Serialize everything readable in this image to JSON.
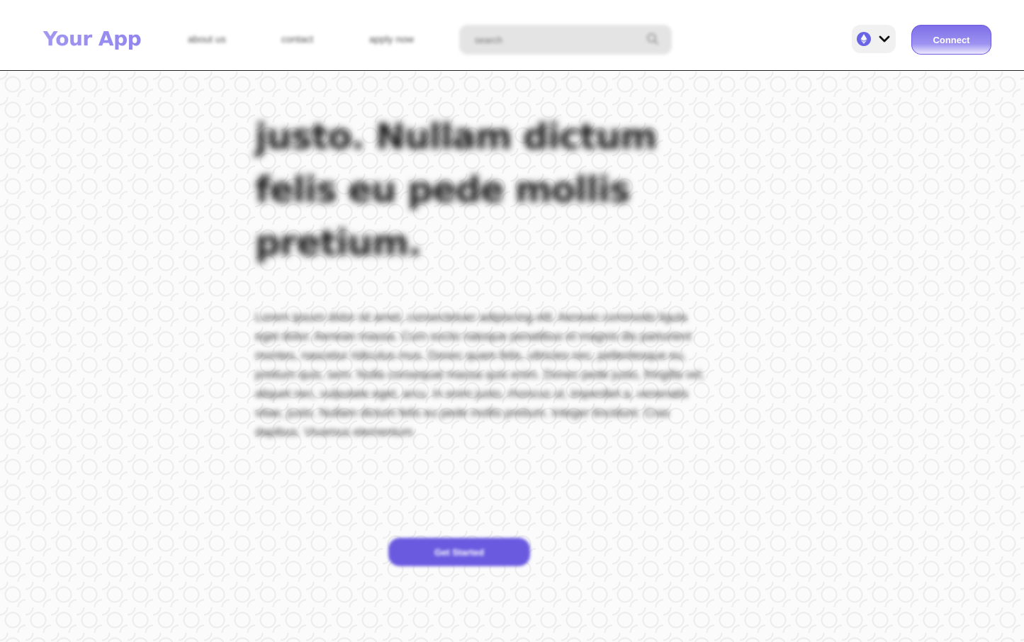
{
  "header": {
    "logo": "Your App",
    "nav": [
      {
        "label": "about us"
      },
      {
        "label": "contact"
      },
      {
        "label": "apply now"
      }
    ],
    "search": {
      "placeholder": "search",
      "icon": "search-icon"
    },
    "network": {
      "icon": "ethereum-icon",
      "dropdown_icon": "chevron-down-icon",
      "accent": "#6a64e6"
    },
    "connect_label": "Connect"
  },
  "hero": {
    "headline": "justo. Nullam dictum felis eu pede mollis pretium.",
    "body": "Lorem ipsum dolor sit amet, consectetuer adipiscing elit. Aenean commodo ligula eget dolor. Aenean massa. Cum sociis natoque penatibus et magnis dis parturient montes, nascetur ridiculus mus. Donec quam felis, ultricies nec, pellentesque eu, pretium quis, sem. Nulla consequat massa quis enim. Donec pede justo, fringilla vel, aliquet nec, vulputate eget, arcu. In enim justo, rhoncus ut, imperdiet a, venenatis vitae, justo. Nullam dictum felis eu pede mollis pretium. Integer tincidunt. Cras dapibus. Vivamus elementum",
    "cta_label": "Get Started"
  },
  "colors": {
    "brand": "#6a5ae0",
    "logo_gradient_start": "#a79cf2",
    "logo_gradient_end": "#8f84ee"
  }
}
